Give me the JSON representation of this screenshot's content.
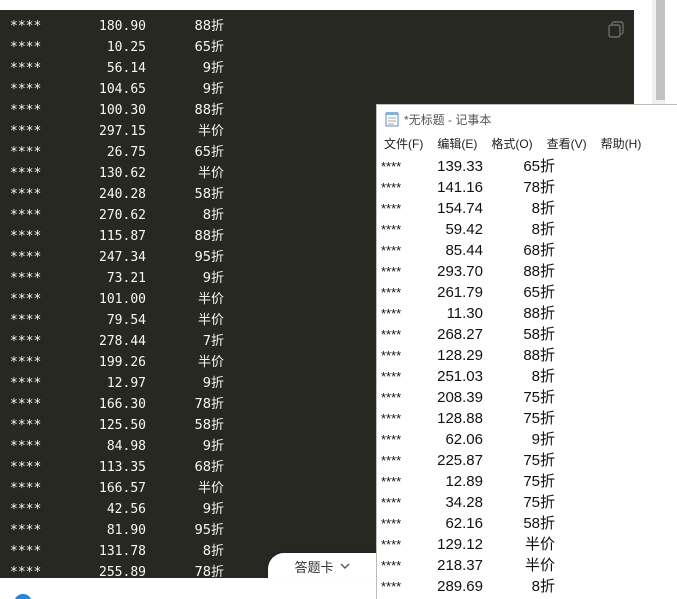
{
  "console": {
    "icon": "copy-icon",
    "rows": [
      {
        "stars": "****",
        "price": "180.90",
        "discount": "88折"
      },
      {
        "stars": "****",
        "price": "10.25",
        "discount": "65折"
      },
      {
        "stars": "****",
        "price": "56.14",
        "discount": "9折"
      },
      {
        "stars": "****",
        "price": "104.65",
        "discount": "9折"
      },
      {
        "stars": "****",
        "price": "100.30",
        "discount": "88折"
      },
      {
        "stars": "****",
        "price": "297.15",
        "discount": "半价"
      },
      {
        "stars": "****",
        "price": "26.75",
        "discount": "65折"
      },
      {
        "stars": "****",
        "price": "130.62",
        "discount": "半价"
      },
      {
        "stars": "****",
        "price": "240.28",
        "discount": "58折"
      },
      {
        "stars": "****",
        "price": "270.62",
        "discount": "8折"
      },
      {
        "stars": "****",
        "price": "115.87",
        "discount": "88折"
      },
      {
        "stars": "****",
        "price": "247.34",
        "discount": "95折"
      },
      {
        "stars": "****",
        "price": "73.21",
        "discount": "9折"
      },
      {
        "stars": "****",
        "price": "101.00",
        "discount": "半价"
      },
      {
        "stars": "****",
        "price": "79.54",
        "discount": "半价"
      },
      {
        "stars": "****",
        "price": "278.44",
        "discount": "7折"
      },
      {
        "stars": "****",
        "price": "199.26",
        "discount": "半价"
      },
      {
        "stars": "****",
        "price": "12.97",
        "discount": "9折"
      },
      {
        "stars": "****",
        "price": "166.30",
        "discount": "78折"
      },
      {
        "stars": "****",
        "price": "125.50",
        "discount": "58折"
      },
      {
        "stars": "****",
        "price": "84.98",
        "discount": "9折"
      },
      {
        "stars": "****",
        "price": "113.35",
        "discount": "68折"
      },
      {
        "stars": "****",
        "price": "166.57",
        "discount": "半价"
      },
      {
        "stars": "****",
        "price": "42.56",
        "discount": "9折"
      },
      {
        "stars": "****",
        "price": "81.90",
        "discount": "95折"
      },
      {
        "stars": "****",
        "price": "131.78",
        "discount": "8折"
      },
      {
        "stars": "****",
        "price": "255.89",
        "discount": "78折"
      }
    ]
  },
  "notepad": {
    "title": "*无标题 - 记事本",
    "icon": "notepad-icon",
    "menu": [
      "文件(F)",
      "编辑(E)",
      "格式(O)",
      "查看(V)",
      "帮助(H)"
    ],
    "rows": [
      {
        "stars": "****",
        "price": "139.33",
        "discount": "65折"
      },
      {
        "stars": "****",
        "price": "141.16",
        "discount": "78折"
      },
      {
        "stars": "****",
        "price": "154.74",
        "discount": "8折"
      },
      {
        "stars": "****",
        "price": "59.42",
        "discount": "8折"
      },
      {
        "stars": "****",
        "price": "85.44",
        "discount": "68折"
      },
      {
        "stars": "****",
        "price": "293.70",
        "discount": "88折"
      },
      {
        "stars": "****",
        "price": "261.79",
        "discount": "65折"
      },
      {
        "stars": "****",
        "price": "11.30",
        "discount": "88折"
      },
      {
        "stars": "****",
        "price": "268.27",
        "discount": "58折"
      },
      {
        "stars": "****",
        "price": "128.29",
        "discount": "88折"
      },
      {
        "stars": "****",
        "price": "251.03",
        "discount": "8折"
      },
      {
        "stars": "****",
        "price": "208.39",
        "discount": "75折"
      },
      {
        "stars": "****",
        "price": "128.88",
        "discount": "75折"
      },
      {
        "stars": "****",
        "price": "62.06",
        "discount": "9折"
      },
      {
        "stars": "****",
        "price": "225.87",
        "discount": "75折"
      },
      {
        "stars": "****",
        "price": "12.89",
        "discount": "75折"
      },
      {
        "stars": "****",
        "price": "34.28",
        "discount": "75折"
      },
      {
        "stars": "****",
        "price": "62.16",
        "discount": "58折"
      },
      {
        "stars": "****",
        "price": "129.12",
        "discount": "半价"
      },
      {
        "stars": "****",
        "price": "218.37",
        "discount": "半价"
      },
      {
        "stars": "****",
        "price": "289.69",
        "discount": "8折"
      }
    ]
  },
  "answer_card": {
    "label": "答题卡",
    "icon": "chevron-down-icon"
  },
  "colors": {
    "console_bg": "#272822",
    "console_text": "#f8f8f2",
    "accent": "#1e88e5"
  }
}
